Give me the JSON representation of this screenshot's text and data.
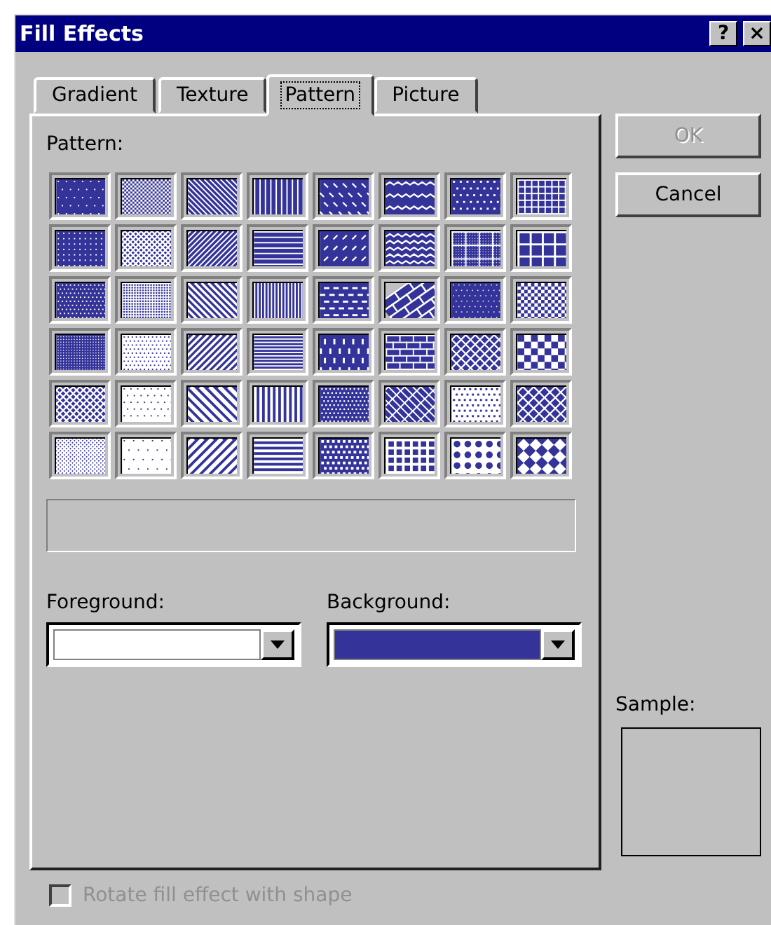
{
  "window": {
    "title": "Fill Effects",
    "help_button": "?",
    "close_button": "×"
  },
  "tabs": [
    {
      "label": "Gradient",
      "selected": false
    },
    {
      "label": "Texture",
      "selected": false
    },
    {
      "label": "Pattern",
      "selected": true
    },
    {
      "label": "Picture",
      "selected": false
    }
  ],
  "pattern_label": "Pattern:",
  "patterns": [
    {
      "kind": "dots-sparse",
      "selected": false
    },
    {
      "kind": "fine-50",
      "selected": false
    },
    {
      "kind": "diag-down-thin",
      "selected": false
    },
    {
      "kind": "vert-thin",
      "selected": false
    },
    {
      "kind": "dash-diag-down",
      "selected": false
    },
    {
      "kind": "wave",
      "selected": false
    },
    {
      "kind": "dots-stagger",
      "selected": false
    },
    {
      "kind": "grid-small",
      "selected": false
    },
    {
      "kind": "dots-medium",
      "selected": false
    },
    {
      "kind": "lattice",
      "selected": false
    },
    {
      "kind": "diag-up-thin",
      "selected": false
    },
    {
      "kind": "horz-thin",
      "selected": false
    },
    {
      "kind": "dash-diag-up",
      "selected": false
    },
    {
      "kind": "wave-dense",
      "selected": false
    },
    {
      "kind": "dotted-grid",
      "selected": false
    },
    {
      "kind": "grid-large",
      "selected": false
    },
    {
      "kind": "dots-dense",
      "selected": false
    },
    {
      "kind": "fine-grid",
      "selected": false
    },
    {
      "kind": "diag-down-medium",
      "selected": false
    },
    {
      "kind": "vert-dense",
      "selected": false
    },
    {
      "kind": "dash-horz",
      "selected": false
    },
    {
      "kind": "diag-brick",
      "selected": false
    },
    {
      "kind": "dots-small",
      "selected": false
    },
    {
      "kind": "check-small",
      "selected": false
    },
    {
      "kind": "dots-tight",
      "selected": false
    },
    {
      "kind": "white-dots",
      "selected": false
    },
    {
      "kind": "diag-up-medium",
      "selected": false
    },
    {
      "kind": "horz-dense",
      "selected": false
    },
    {
      "kind": "dash-vert",
      "selected": false
    },
    {
      "kind": "brick",
      "selected": false
    },
    {
      "kind": "weave",
      "selected": false
    },
    {
      "kind": "check-large",
      "selected": false
    },
    {
      "kind": "diamond-lattice",
      "selected": false
    },
    {
      "kind": "white-dots-sparse",
      "selected": false
    },
    {
      "kind": "diag-down-wide",
      "selected": false
    },
    {
      "kind": "vert-wide",
      "selected": false
    },
    {
      "kind": "confetti",
      "selected": false
    },
    {
      "kind": "herringbone",
      "selected": false
    },
    {
      "kind": "white-dots-medium",
      "selected": false
    },
    {
      "kind": "diamond-outline",
      "selected": false
    },
    {
      "kind": "lattice-plus",
      "selected": false
    },
    {
      "kind": "white-dots-wide",
      "selected": false
    },
    {
      "kind": "diag-up-wide",
      "selected": false
    },
    {
      "kind": "horz-wide",
      "selected": false
    },
    {
      "kind": "squares",
      "selected": false
    },
    {
      "kind": "plaid",
      "selected": false
    },
    {
      "kind": "circles",
      "selected": false
    },
    {
      "kind": "diamond-solid",
      "selected": false
    }
  ],
  "foreground": {
    "label": "Foreground:",
    "color": "#ffffff"
  },
  "background": {
    "label": "Background:",
    "color": "#333399"
  },
  "buttons": [
    {
      "label": "OK",
      "disabled": true
    },
    {
      "label": "Cancel",
      "disabled": false
    }
  ],
  "sample": {
    "label": "Sample:"
  },
  "rotate_checkbox": {
    "label": "Rotate fill effect with shape",
    "checked": false,
    "disabled": true
  }
}
